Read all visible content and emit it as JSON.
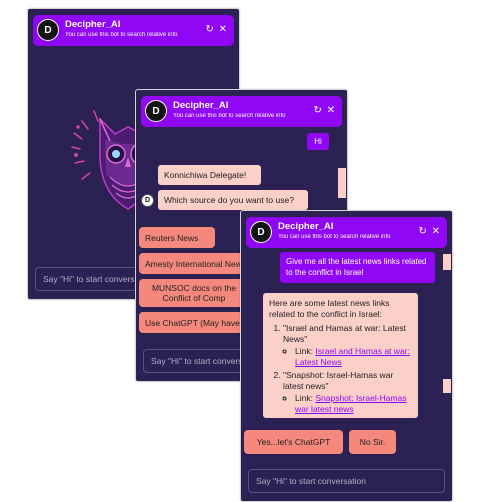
{
  "app": {
    "title": "Decipher_AI",
    "subtitle": "You can use this bot to search relative info",
    "avatar_letter": "D",
    "back_icon": "↻",
    "close_icon": "✕",
    "input_placeholder": "Say \"Hi\" to start conversation"
  },
  "window1": {
    "input_placeholder": "Say \"Hi\" to start conversation"
  },
  "window2": {
    "user_msg": "Hi",
    "bot_greeting": "Konnichiwa Delegate!",
    "bot_question": "Which source do you want to use?",
    "options": [
      "Reuters News",
      "Amesty International News",
      "MUNSOC docs on the Conflict of Comp",
      "Use ChatGPT (May have limited knowledge)"
    ],
    "input_placeholder": "Say \"Hi\" to start conversation"
  },
  "window3": {
    "user_msg": "Give me all the latest news links related to the conflict in Israel",
    "bot_intro": "Here are some latest news links related to the conflict in Israel:",
    "items": [
      {
        "title": "\"Israel and Hamas at war: Latest News\"",
        "link_label": "Link:",
        "link_text": "Israel and Hamas at war: Latest News"
      },
      {
        "title": "\"Snapshot: Israel-Hamas war latest news\"",
        "link_label": "Link:",
        "link_text": "Snapshot: Israel-Hamas war latest news"
      }
    ],
    "buttons": [
      "Yes...let's ChatGPT",
      "No Sir."
    ],
    "input_placeholder": "Say \"Hi\" to start conversation"
  },
  "colors": {
    "background": "#2c2153",
    "header": "#8f07f4",
    "bot_bubble": "#fbd0c9",
    "option_button": "#f4887d"
  }
}
